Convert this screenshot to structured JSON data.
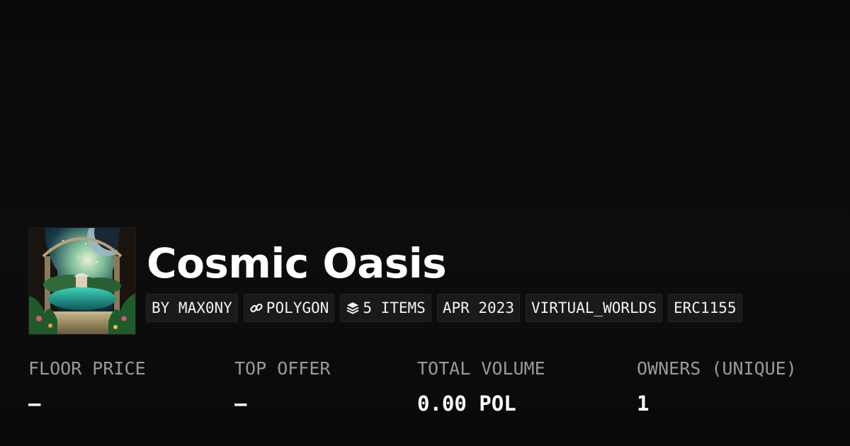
{
  "collection": {
    "title": "Cosmic Oasis",
    "thumbnail_alt": "collection-thumbnail"
  },
  "chips": [
    {
      "label": "BY MAX0NY",
      "icon": ""
    },
    {
      "label": "POLYGON",
      "icon": "chain-link-icon"
    },
    {
      "label": "5 ITEMS",
      "icon": "layers-icon"
    },
    {
      "label": "APR 2023",
      "icon": ""
    },
    {
      "label": "VIRTUAL_WORLDS",
      "icon": ""
    },
    {
      "label": "ERC1155",
      "icon": ""
    }
  ],
  "stats": [
    {
      "label": "FLOOR PRICE",
      "value": "–"
    },
    {
      "label": "TOP OFFER",
      "value": "–"
    },
    {
      "label": "TOTAL VOLUME",
      "value": "0.00 POL"
    },
    {
      "label": "OWNERS (UNIQUE)",
      "value": "1"
    }
  ],
  "colors": {
    "background": "#0b0b0b",
    "chip_background": "#1a1a1a",
    "label_gray": "#9a9a9a",
    "text_white": "#ffffff"
  }
}
